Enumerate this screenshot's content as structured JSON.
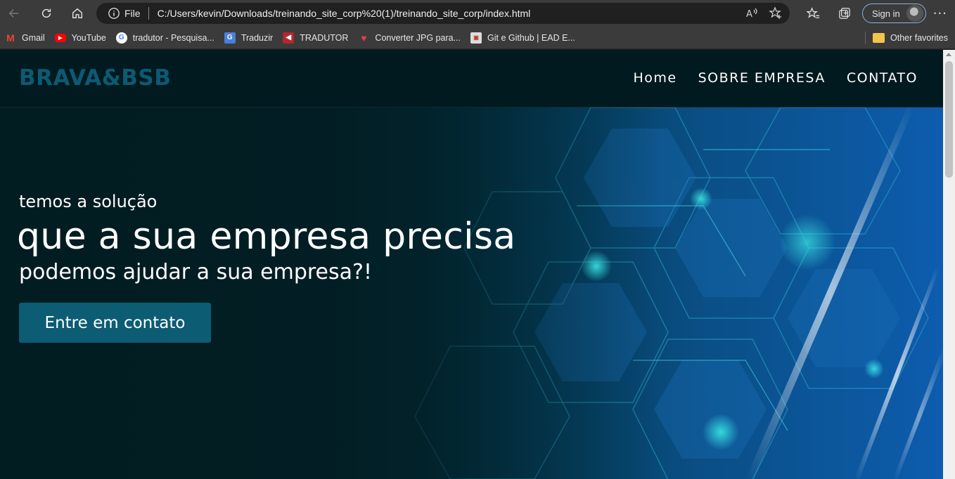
{
  "browser": {
    "address_prefix": "File",
    "url": "C:/Users/kevin/Downloads/treinando_site_corp%20(1)/treinando_site_corp/index.html",
    "sign_in_label": "Sign in",
    "more_label": "···",
    "bookmarks": [
      {
        "label": "Gmail",
        "icon": "gmail-icon",
        "color": "#ea4335"
      },
      {
        "label": "YouTube",
        "icon": "youtube-icon",
        "color": "#ff0000"
      },
      {
        "label": "tradutor - Pesquisa...",
        "icon": "google-icon",
        "color": "#4285f4"
      },
      {
        "label": "Traduzir",
        "icon": "translate-icon",
        "color": "#4a7fd6"
      },
      {
        "label": "TRADUTOR",
        "icon": "speaker-icon",
        "color": "#b3262a"
      },
      {
        "label": "Converter JPG para...",
        "icon": "heart-icon",
        "color": "#e0404a"
      },
      {
        "label": "Git e Github | EAD E...",
        "icon": "ead-icon",
        "color": "#dcdcdc"
      }
    ],
    "other_favorites": "Other favorites"
  },
  "site": {
    "logo": "BRAVA&BSB",
    "nav": [
      "Home",
      "SOBRE EMPRESA",
      "CONTATO"
    ],
    "hero": {
      "line1": "temos a solução",
      "line2": "que a sua empresa precisa",
      "line3": "podemos ajudar a sua empresa?!",
      "cta": "Entre em contato"
    }
  },
  "colors": {
    "logo": "#0c5a73",
    "cta_bg": "#0c5c73",
    "header_bg": "#011a1f"
  }
}
